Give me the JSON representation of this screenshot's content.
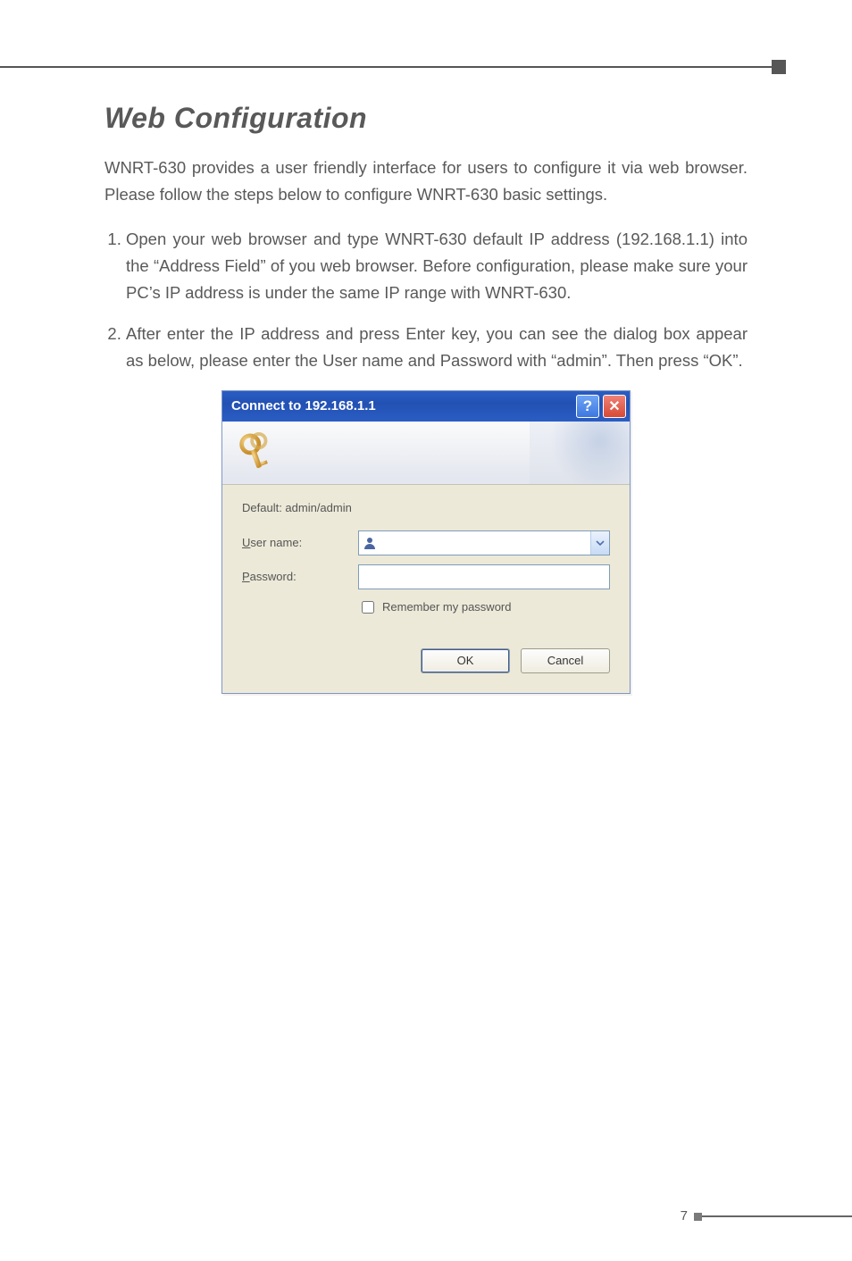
{
  "heading": "Web Configuration",
  "intro": "WNRT-630 provides a user friendly interface for users to configure it via web browser. Please follow the steps below to configure WNRT-630 basic settings.",
  "steps": [
    "Open your web browser and type WNRT-630 default IP address (192.168.1.1) into the “Address Field” of you web browser. Before configuration, please make sure your PC’s IP address is under the same IP range with WNRT-630.",
    "After enter the IP address and press Enter key, you can see the dialog box appear as below, please enter the User name and Password with “admin”. Then press “OK”."
  ],
  "dialog": {
    "title": "Connect to 192.168.1.1",
    "realm": "Default: admin/admin",
    "username_label_pre": "U",
    "username_label_post": "ser name:",
    "password_label_pre": "P",
    "password_label_post": "assword:",
    "username_value": "",
    "password_value": "",
    "remember_pre": "R",
    "remember_post": "emember my password",
    "remember_checked": false,
    "ok_label": "OK",
    "cancel_label": "Cancel"
  },
  "page_number": "7"
}
